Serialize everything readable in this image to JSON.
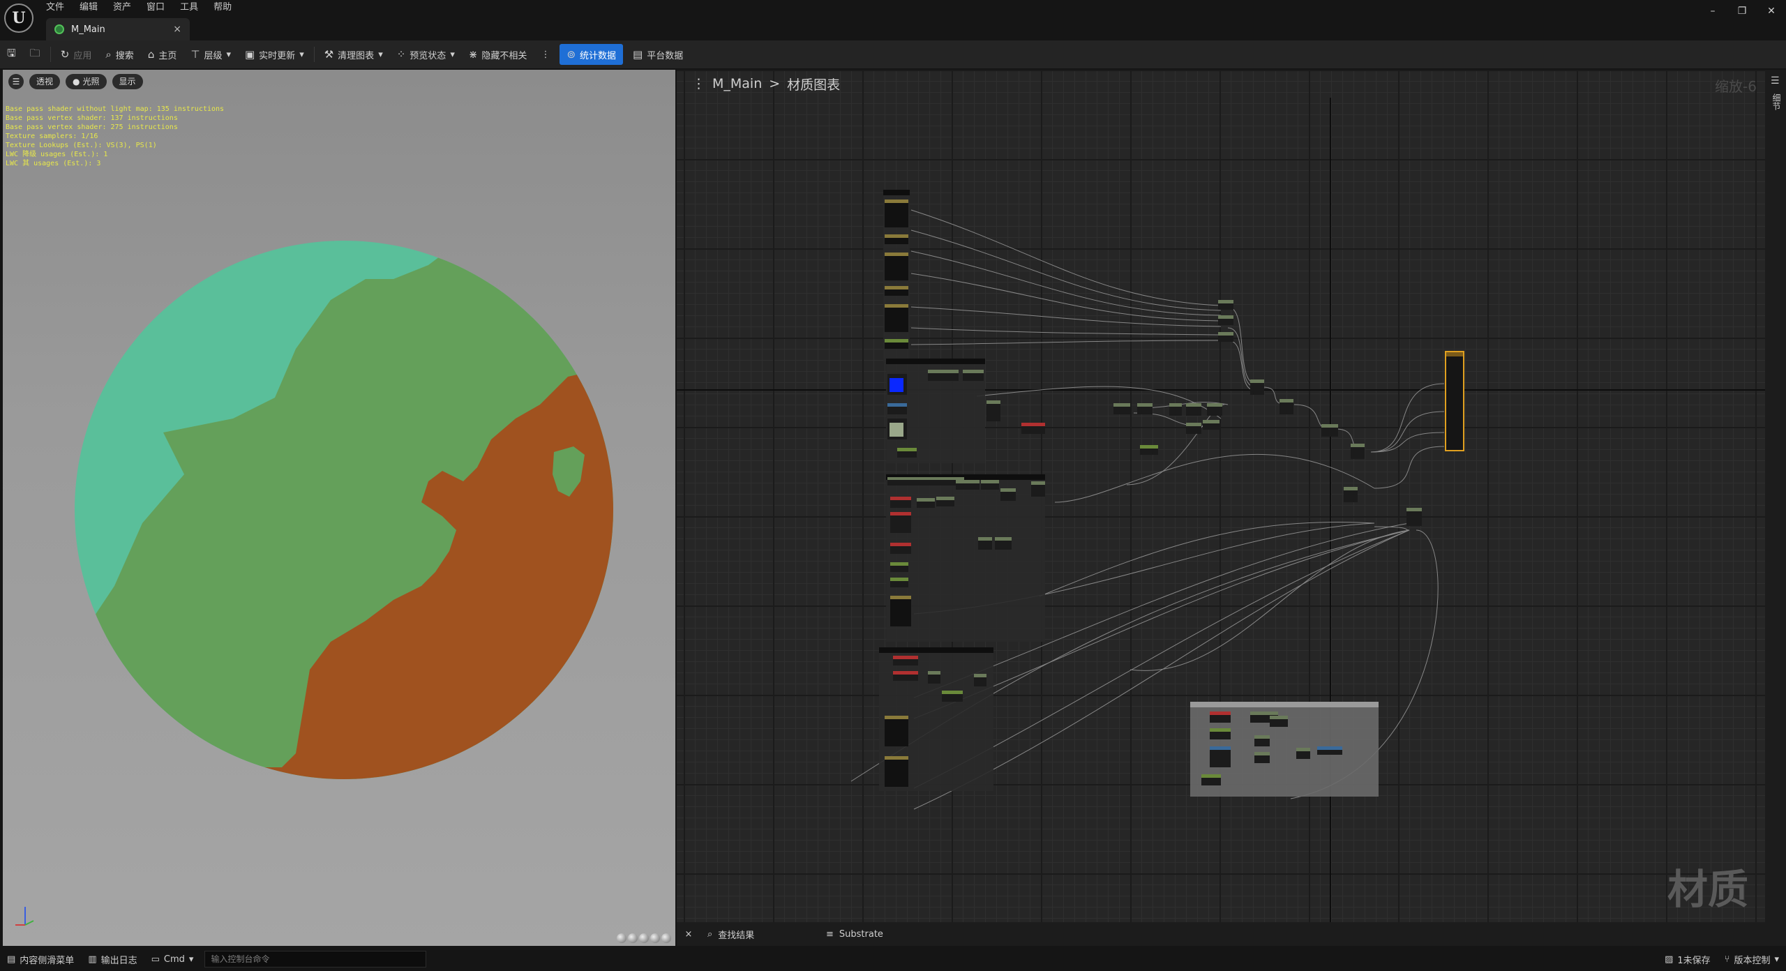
{
  "menu": [
    "文件",
    "编辑",
    "资产",
    "窗口",
    "工具",
    "帮助"
  ],
  "tab": {
    "title": "M_Main",
    "close": "×"
  },
  "window_controls": [
    "–",
    "❐",
    "✕"
  ],
  "toolbar": {
    "apply": "应用",
    "search": "搜索",
    "home": "主页",
    "hierarchy": "层级",
    "live_update": "实时更新",
    "clean_graph": "清理图表",
    "preview_state": "预览状态",
    "hide_unrelated": "隐藏不相关",
    "stats": "统计数据",
    "platform_stats": "平台数据"
  },
  "viewport": {
    "buttons": [
      "透视",
      "光照",
      "显示"
    ],
    "stats_lines": [
      "Base pass shader without light map: 135 instructions",
      "Base pass vertex shader: 137 instructions",
      "Base pass vertex shader: 275 instructions",
      "Texture samplers: 1/16",
      "Texture Lookups (Est.): VS(3), PS(1)",
      "LWC 降级 usages (Est.): 1",
      "LWC 其 usages (Est.): 3"
    ],
    "colors": {
      "ocean": "#5abf9a",
      "land": "#64a05a",
      "desert": "#a0521f"
    }
  },
  "graph": {
    "breadcrumb_root": "M_Main",
    "breadcrumb_sep": ">",
    "breadcrumb_current": "材质图表",
    "zoom": "缩放-6",
    "watermark": "材质",
    "details_tab": "细节"
  },
  "graph_bottom": {
    "close": "×",
    "find_results": "查找结果",
    "substrate": "Substrate"
  },
  "status": {
    "content_drawer": "内容侧滑菜单",
    "output_log": "输出日志",
    "cmd": "Cmd",
    "cmd_placeholder": "输入控制台命令",
    "unsaved": "1未保存",
    "source_control": "版本控制"
  }
}
